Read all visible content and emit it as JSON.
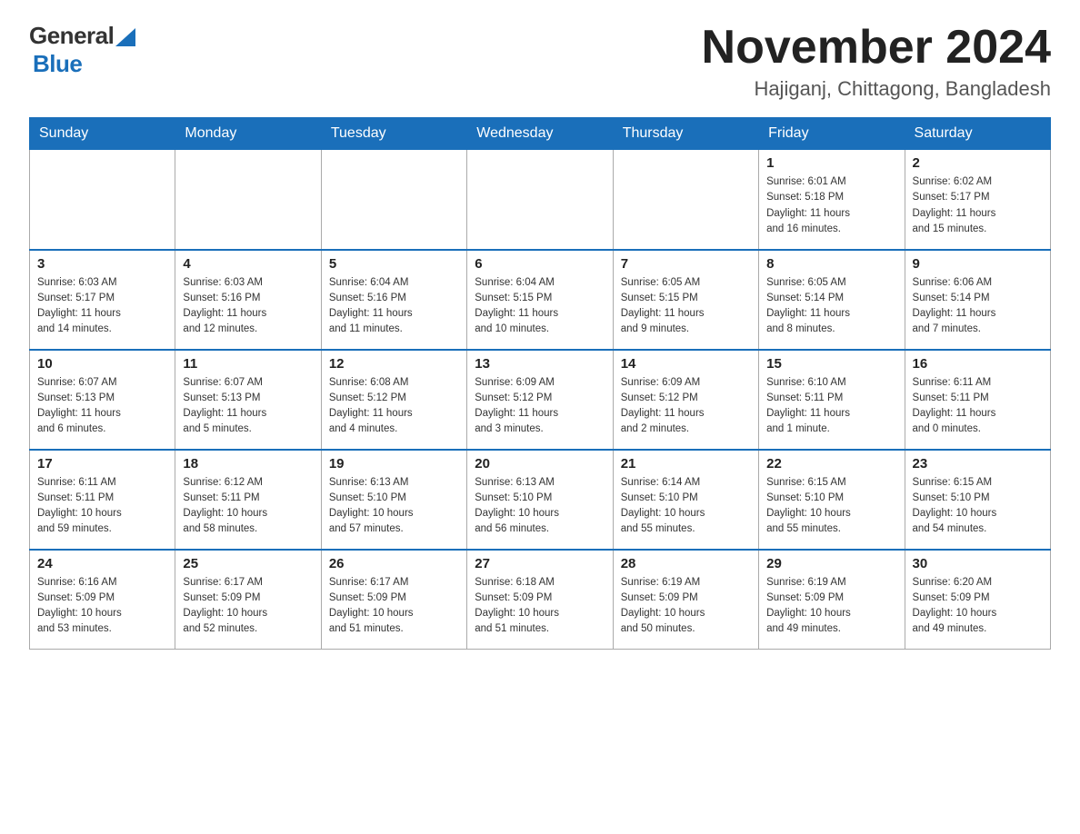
{
  "header": {
    "logo_general": "General",
    "logo_blue": "Blue",
    "month_title": "November 2024",
    "location": "Hajiganj, Chittagong, Bangladesh"
  },
  "days_of_week": [
    "Sunday",
    "Monday",
    "Tuesday",
    "Wednesday",
    "Thursday",
    "Friday",
    "Saturday"
  ],
  "weeks": [
    [
      {
        "day": "",
        "info": ""
      },
      {
        "day": "",
        "info": ""
      },
      {
        "day": "",
        "info": ""
      },
      {
        "day": "",
        "info": ""
      },
      {
        "day": "",
        "info": ""
      },
      {
        "day": "1",
        "info": "Sunrise: 6:01 AM\nSunset: 5:18 PM\nDaylight: 11 hours\nand 16 minutes."
      },
      {
        "day": "2",
        "info": "Sunrise: 6:02 AM\nSunset: 5:17 PM\nDaylight: 11 hours\nand 15 minutes."
      }
    ],
    [
      {
        "day": "3",
        "info": "Sunrise: 6:03 AM\nSunset: 5:17 PM\nDaylight: 11 hours\nand 14 minutes."
      },
      {
        "day": "4",
        "info": "Sunrise: 6:03 AM\nSunset: 5:16 PM\nDaylight: 11 hours\nand 12 minutes."
      },
      {
        "day": "5",
        "info": "Sunrise: 6:04 AM\nSunset: 5:16 PM\nDaylight: 11 hours\nand 11 minutes."
      },
      {
        "day": "6",
        "info": "Sunrise: 6:04 AM\nSunset: 5:15 PM\nDaylight: 11 hours\nand 10 minutes."
      },
      {
        "day": "7",
        "info": "Sunrise: 6:05 AM\nSunset: 5:15 PM\nDaylight: 11 hours\nand 9 minutes."
      },
      {
        "day": "8",
        "info": "Sunrise: 6:05 AM\nSunset: 5:14 PM\nDaylight: 11 hours\nand 8 minutes."
      },
      {
        "day": "9",
        "info": "Sunrise: 6:06 AM\nSunset: 5:14 PM\nDaylight: 11 hours\nand 7 minutes."
      }
    ],
    [
      {
        "day": "10",
        "info": "Sunrise: 6:07 AM\nSunset: 5:13 PM\nDaylight: 11 hours\nand 6 minutes."
      },
      {
        "day": "11",
        "info": "Sunrise: 6:07 AM\nSunset: 5:13 PM\nDaylight: 11 hours\nand 5 minutes."
      },
      {
        "day": "12",
        "info": "Sunrise: 6:08 AM\nSunset: 5:12 PM\nDaylight: 11 hours\nand 4 minutes."
      },
      {
        "day": "13",
        "info": "Sunrise: 6:09 AM\nSunset: 5:12 PM\nDaylight: 11 hours\nand 3 minutes."
      },
      {
        "day": "14",
        "info": "Sunrise: 6:09 AM\nSunset: 5:12 PM\nDaylight: 11 hours\nand 2 minutes."
      },
      {
        "day": "15",
        "info": "Sunrise: 6:10 AM\nSunset: 5:11 PM\nDaylight: 11 hours\nand 1 minute."
      },
      {
        "day": "16",
        "info": "Sunrise: 6:11 AM\nSunset: 5:11 PM\nDaylight: 11 hours\nand 0 minutes."
      }
    ],
    [
      {
        "day": "17",
        "info": "Sunrise: 6:11 AM\nSunset: 5:11 PM\nDaylight: 10 hours\nand 59 minutes."
      },
      {
        "day": "18",
        "info": "Sunrise: 6:12 AM\nSunset: 5:11 PM\nDaylight: 10 hours\nand 58 minutes."
      },
      {
        "day": "19",
        "info": "Sunrise: 6:13 AM\nSunset: 5:10 PM\nDaylight: 10 hours\nand 57 minutes."
      },
      {
        "day": "20",
        "info": "Sunrise: 6:13 AM\nSunset: 5:10 PM\nDaylight: 10 hours\nand 56 minutes."
      },
      {
        "day": "21",
        "info": "Sunrise: 6:14 AM\nSunset: 5:10 PM\nDaylight: 10 hours\nand 55 minutes."
      },
      {
        "day": "22",
        "info": "Sunrise: 6:15 AM\nSunset: 5:10 PM\nDaylight: 10 hours\nand 55 minutes."
      },
      {
        "day": "23",
        "info": "Sunrise: 6:15 AM\nSunset: 5:10 PM\nDaylight: 10 hours\nand 54 minutes."
      }
    ],
    [
      {
        "day": "24",
        "info": "Sunrise: 6:16 AM\nSunset: 5:09 PM\nDaylight: 10 hours\nand 53 minutes."
      },
      {
        "day": "25",
        "info": "Sunrise: 6:17 AM\nSunset: 5:09 PM\nDaylight: 10 hours\nand 52 minutes."
      },
      {
        "day": "26",
        "info": "Sunrise: 6:17 AM\nSunset: 5:09 PM\nDaylight: 10 hours\nand 51 minutes."
      },
      {
        "day": "27",
        "info": "Sunrise: 6:18 AM\nSunset: 5:09 PM\nDaylight: 10 hours\nand 51 minutes."
      },
      {
        "day": "28",
        "info": "Sunrise: 6:19 AM\nSunset: 5:09 PM\nDaylight: 10 hours\nand 50 minutes."
      },
      {
        "day": "29",
        "info": "Sunrise: 6:19 AM\nSunset: 5:09 PM\nDaylight: 10 hours\nand 49 minutes."
      },
      {
        "day": "30",
        "info": "Sunrise: 6:20 AM\nSunset: 5:09 PM\nDaylight: 10 hours\nand 49 minutes."
      }
    ]
  ]
}
